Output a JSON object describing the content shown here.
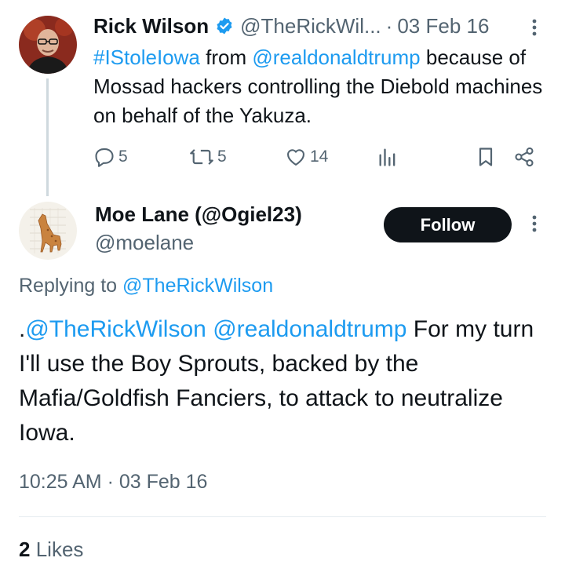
{
  "parent": {
    "name": "Rick Wilson",
    "handle": "@TheRickWil...",
    "separator": "·",
    "date": "03 Feb 16",
    "hashtag": "#IStoleIowa",
    "word_from": "from",
    "mention": "@realdonaldtrump",
    "rest": "because of Mossad hackers controlling the Diebold machines on behalf of the Yakuza.",
    "replies": "5",
    "reposts": "5",
    "likes": "14"
  },
  "main": {
    "name": "Moe Lane (@Ogiel23)",
    "handle": "@moelane",
    "follow_label": "Follow",
    "replying_prefix": "Replying to",
    "replying_to": "@TheRickWilson",
    "text_prefix": ".",
    "mention1": "@TheRickWilson",
    "mention2": "@realdonaldtrump",
    "text_body": "For my turn I'll use the Boy Sprouts, backed by the Mafia/Goldfish Fanciers, to attack to neutralize Iowa.",
    "timestamp": "10:25 AM · 03 Feb 16",
    "likes_count": "2",
    "likes_label": "Likes"
  },
  "colors": {
    "link": "#1d9bf0",
    "text": "#0f1419",
    "muted": "#536471",
    "verified": "#1d9bf0"
  },
  "icons": [
    "verified-badge-icon",
    "more-icon",
    "reply-icon",
    "repost-icon",
    "like-icon",
    "views-icon",
    "bookmark-icon",
    "share-icon"
  ]
}
